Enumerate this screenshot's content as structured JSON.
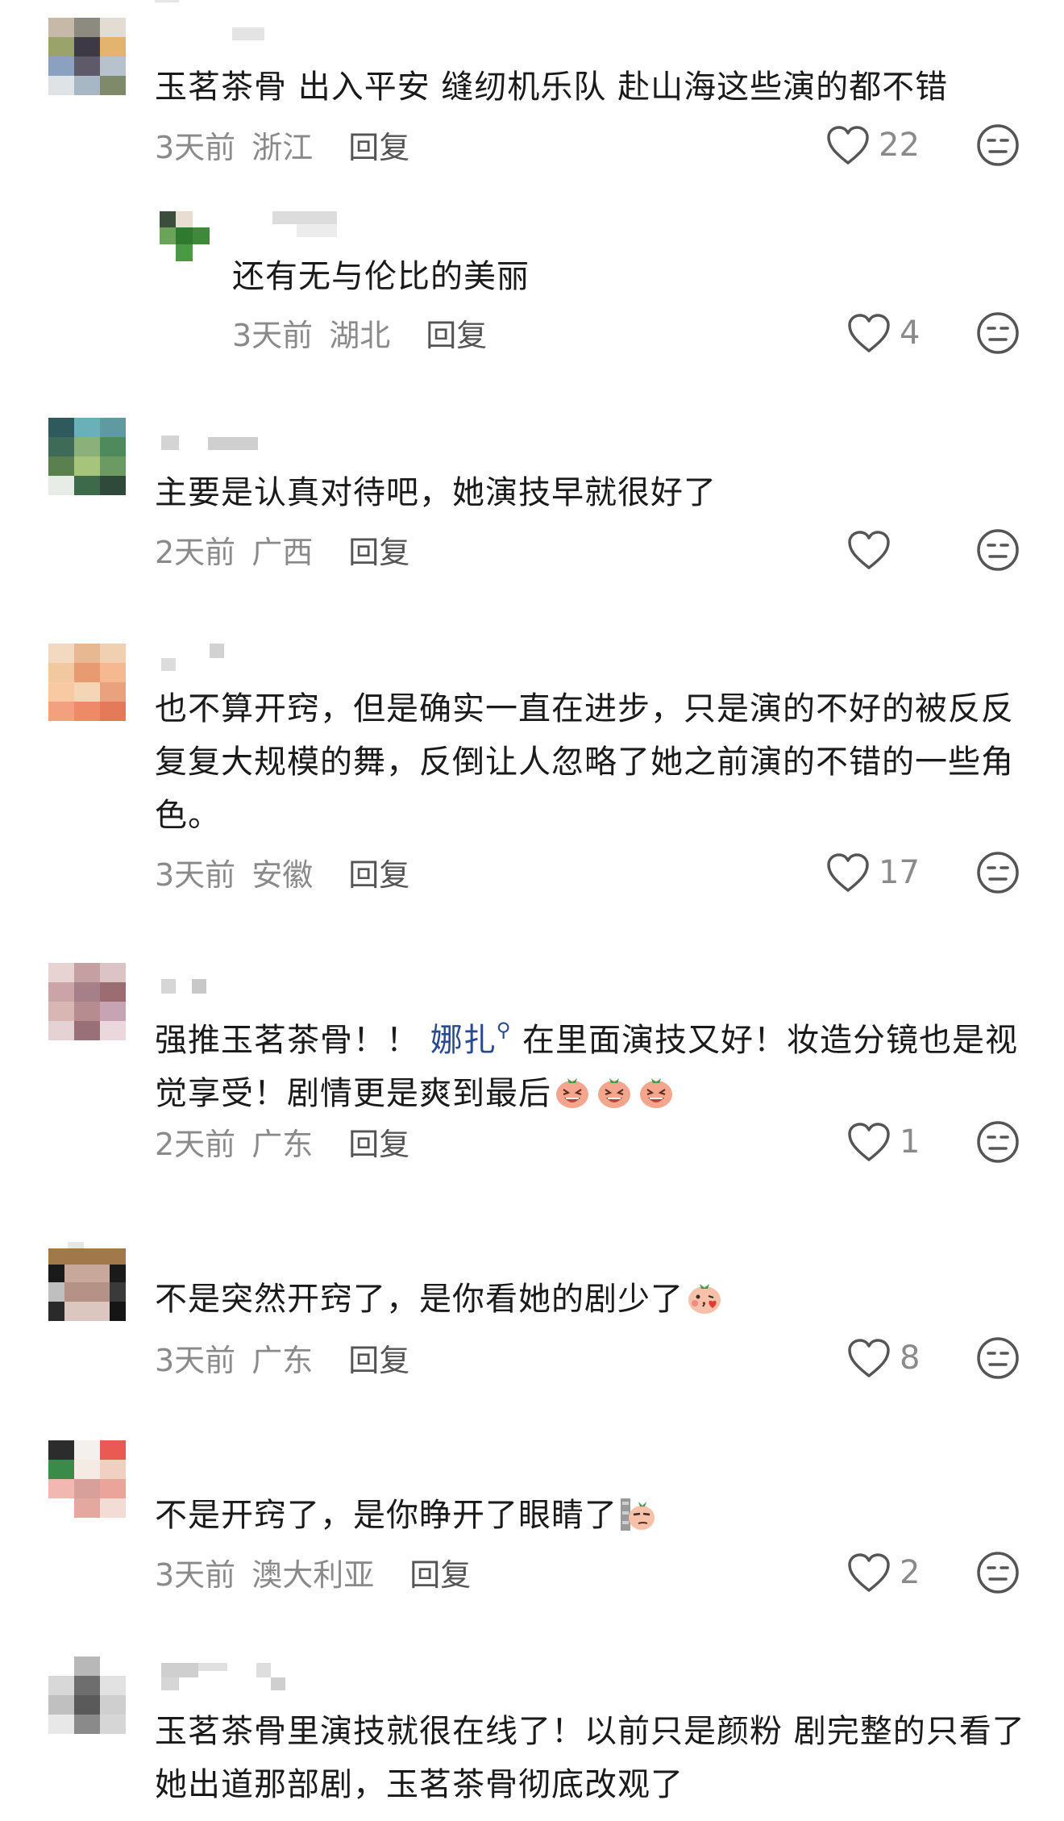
{
  "comments": [
    {
      "text": "玉茗茶骨 出入平安 缝纫机乐队 赴山海这些演的都不错",
      "time": "3天前",
      "location": "浙江",
      "reply_label": "回复",
      "likes": "22"
    },
    {
      "text": "还有无与伦比的美丽",
      "time": "3天前",
      "location": "湖北",
      "reply_label": "回复",
      "likes": "4"
    },
    {
      "text": "主要是认真对待吧，她演技早就很好了",
      "time": "2天前",
      "location": "广西",
      "reply_label": "回复",
      "likes": ""
    },
    {
      "text": "也不算开窍，但是确实一直在进步，只是演的不好的被反反复复大规模的舞，反倒让人忽略了她之前演的不错的一些角色。",
      "time": "3天前",
      "location": "安徽",
      "reply_label": "回复",
      "likes": "17"
    },
    {
      "text_before": "强推玉茗茶骨！！ ",
      "mention": "娜扎",
      "text_after": " 在里面演技又好！妆造分镜也是视觉享受！剧情更是爽到最后",
      "time": "2天前",
      "location": "广东",
      "reply_label": "回复",
      "likes": "1"
    },
    {
      "text": "不是突然开窍了，是你看她的剧少了",
      "time": "3天前",
      "location": "广东",
      "reply_label": "回复",
      "likes": "8"
    },
    {
      "text": "不是开窍了，是你睁开了眼睛了",
      "time": "3天前",
      "location": "澳大利亚",
      "reply_label": "回复",
      "likes": "2"
    },
    {
      "text": "玉茗茶骨里演技就很在线了！以前只是颜粉 剧完整的只看了她出道那部剧，玉茗茶骨彻底改观了"
    }
  ]
}
